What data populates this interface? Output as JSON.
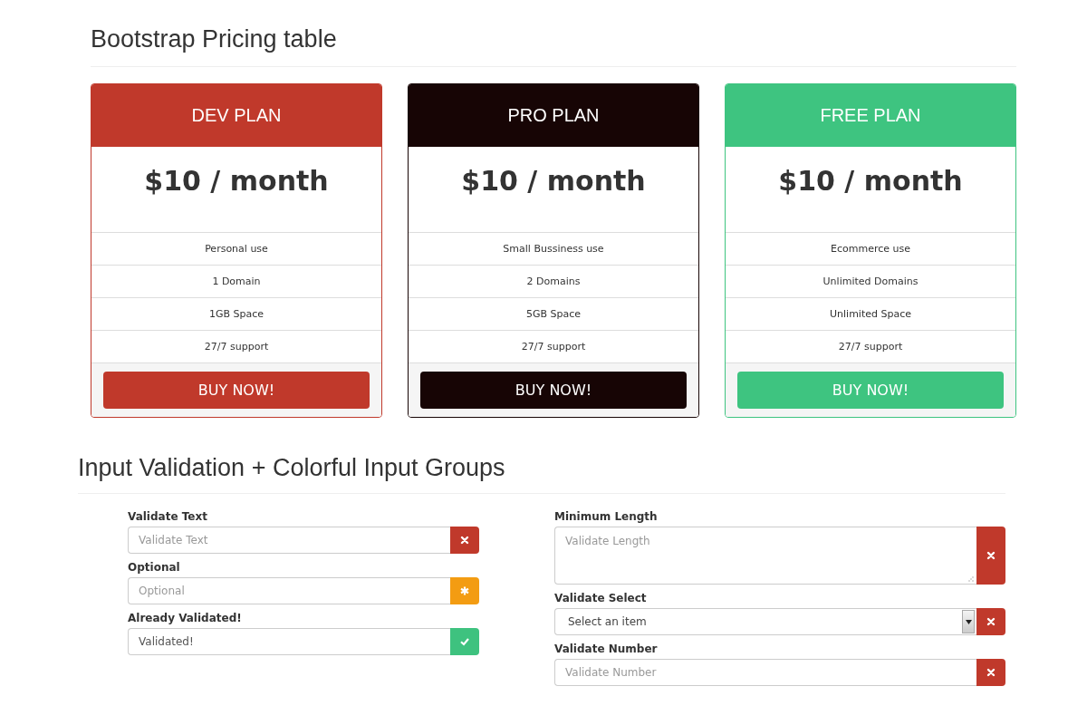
{
  "pricing": {
    "title": "Bootstrap Pricing table",
    "plans": [
      {
        "name": "DEV PLAN",
        "color": "#c0392b",
        "price": "$10 / month",
        "features": [
          "Personal use",
          "1 Domain",
          "1GB Space",
          "27/7 support"
        ],
        "button": "BUY NOW!"
      },
      {
        "name": "PRO PLAN",
        "color": "#170505",
        "price": "$10 / month",
        "features": [
          "Small Bussiness use",
          "2 Domains",
          "5GB Space",
          "27/7 support"
        ],
        "button": "BUY NOW!"
      },
      {
        "name": "FREE PLAN",
        "color": "#3ec480",
        "price": "$10 / month",
        "features": [
          "Ecommerce use",
          "Unlimited Domains",
          "Unlimited Space",
          "27/7 support"
        ],
        "button": "BUY NOW!"
      }
    ]
  },
  "validation": {
    "title": "Input Validation + Colorful Input Groups",
    "columns": [
      [
        {
          "label": "Validate Text",
          "kind": "input",
          "required": true,
          "valid": false,
          "placeholder": "Validate Text"
        },
        {
          "label": "Optional",
          "kind": "input",
          "required": false,
          "valid": false,
          "placeholder": "Optional"
        },
        {
          "label": "Already Validated!",
          "kind": "input",
          "valid": true,
          "value": "Validated!"
        }
      ],
      [
        {
          "label": "Minimum Length",
          "kind": "textarea",
          "required": true,
          "valid": false,
          "placeholder": "Validate Length"
        },
        {
          "label": "Validate Select",
          "kind": "select",
          "required": true,
          "valid": false,
          "value": "Select an item"
        },
        {
          "label": "Validate Number",
          "kind": "input",
          "required": true,
          "valid": false,
          "placeholder": "Validate Number"
        }
      ]
    ]
  }
}
